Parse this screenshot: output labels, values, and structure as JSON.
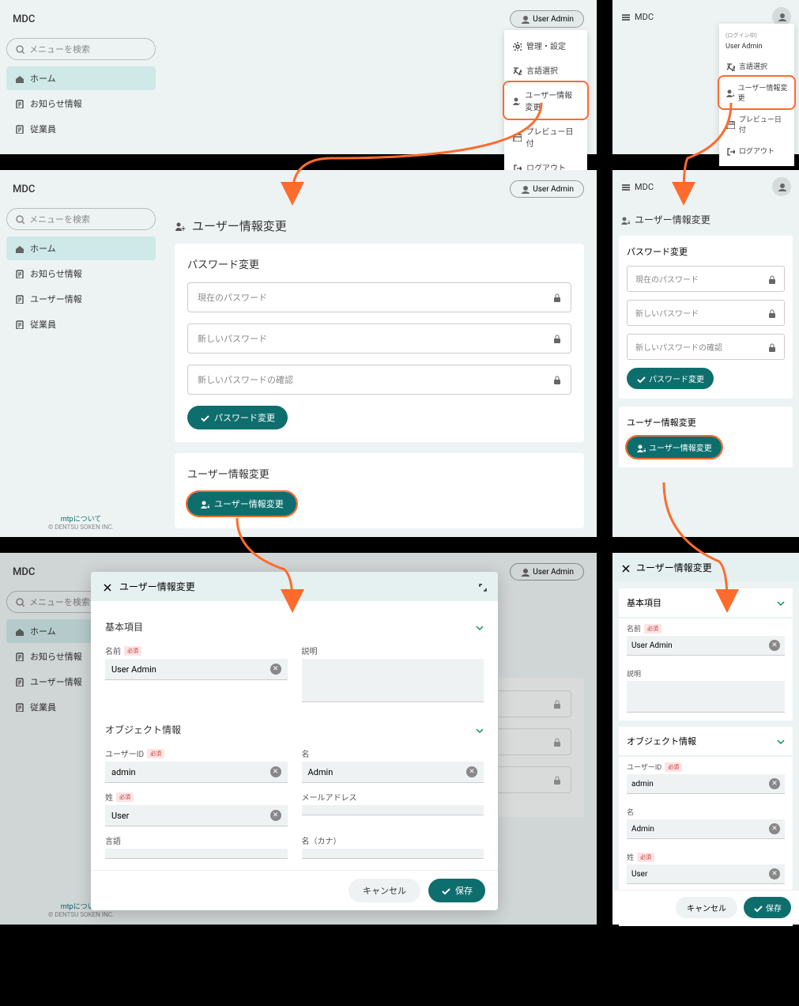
{
  "app": {
    "name": "MDC"
  },
  "user": {
    "label": "User Admin",
    "logged_in_label": "(ログイン中)"
  },
  "search": {
    "placeholder": "メニューを検索"
  },
  "nav": {
    "home": "ホーム",
    "notice": "お知らせ情報",
    "userinfo": "ユーザー情報",
    "employee": "従業員"
  },
  "menu": {
    "admin": "管理・設定",
    "lang": "言語選択",
    "userchange": "ユーザー情報変更",
    "previewdate": "プレビュー日付",
    "logout": "ログアウト"
  },
  "page": {
    "title": "ユーザー情報変更",
    "pw_section": "パスワード変更",
    "pw_current": "現在のパスワード",
    "pw_new": "新しいパスワード",
    "pw_confirm": "新しいパスワードの確認",
    "pw_button": "パスワード変更",
    "ui_section": "ユーザー情報変更",
    "ui_button": "ユーザー情報変更"
  },
  "dialog": {
    "title": "ユーザー情報変更",
    "basic": "基本項目",
    "name": "名前",
    "name_val": "User Admin",
    "desc": "説明",
    "object": "オブジェクト情報",
    "userid": "ユーザーID",
    "userid_val": "admin",
    "first": "名",
    "first_val": "Admin",
    "last": "姓",
    "last_val": "User",
    "email": "メールアドレス",
    "lang": "言語",
    "first_kana": "名（カナ）",
    "req": "必須",
    "cancel": "キャンセル",
    "save": "保存"
  },
  "footer": {
    "about": "mtpについて",
    "copy": "© DENTSU SOKEN INC."
  }
}
